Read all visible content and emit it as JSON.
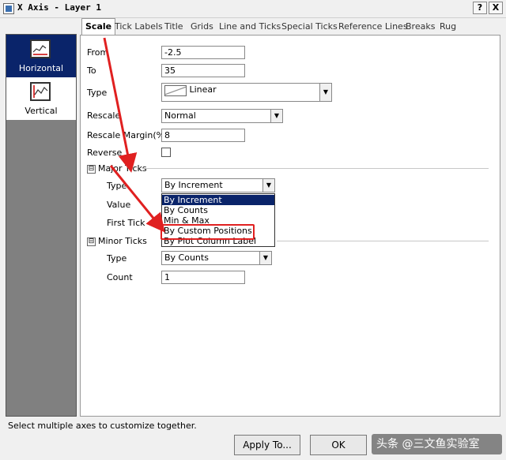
{
  "window": {
    "title": "X Axis - Layer 1",
    "help_label": "?",
    "close_label": "X"
  },
  "sidebar": {
    "items": [
      {
        "label": "Horizontal",
        "icon": "horizontal-axis-icon"
      },
      {
        "label": "Vertical",
        "icon": "vertical-axis-icon"
      }
    ]
  },
  "tabs": [
    {
      "label": "Scale"
    },
    {
      "label": "Tick Labels"
    },
    {
      "label": "Title"
    },
    {
      "label": "Grids"
    },
    {
      "label": "Line and Ticks"
    },
    {
      "label": "Special Ticks"
    },
    {
      "label": "Reference Lines"
    },
    {
      "label": "Breaks"
    },
    {
      "label": "Rug"
    }
  ],
  "scale": {
    "from_label": "From",
    "from_value": "-2.5",
    "to_label": "To",
    "to_value": "35",
    "type_label": "Type",
    "type_value": "Linear",
    "rescale_label": "Rescale",
    "rescale_value": "Normal",
    "rescale_margin_label": "Rescale Margin(%)",
    "rescale_margin_value": "8",
    "reverse_label": "Reverse"
  },
  "major_ticks": {
    "section_label": "Major Ticks",
    "toggle": "⊟",
    "type_label": "Type",
    "type_value": "By Increment",
    "value_label": "Value",
    "first_tick_label": "First Tick",
    "options": [
      "By Increment",
      "By Counts",
      "Min & Max",
      "By Custom Positions",
      "By Plot Column Label"
    ]
  },
  "minor_ticks": {
    "section_label": "Minor Ticks",
    "toggle": "⊟",
    "type_label": "Type",
    "type_value": "By Counts",
    "count_label": "Count",
    "count_value": "1"
  },
  "status_text": "Select multiple axes to customize together.",
  "buttons": {
    "apply_to": "Apply To...",
    "ok": "OK"
  },
  "watermark": "头条 @三文鱼实验室",
  "colors": {
    "selection": "#0a246a",
    "annotation_red": "#e02020"
  }
}
